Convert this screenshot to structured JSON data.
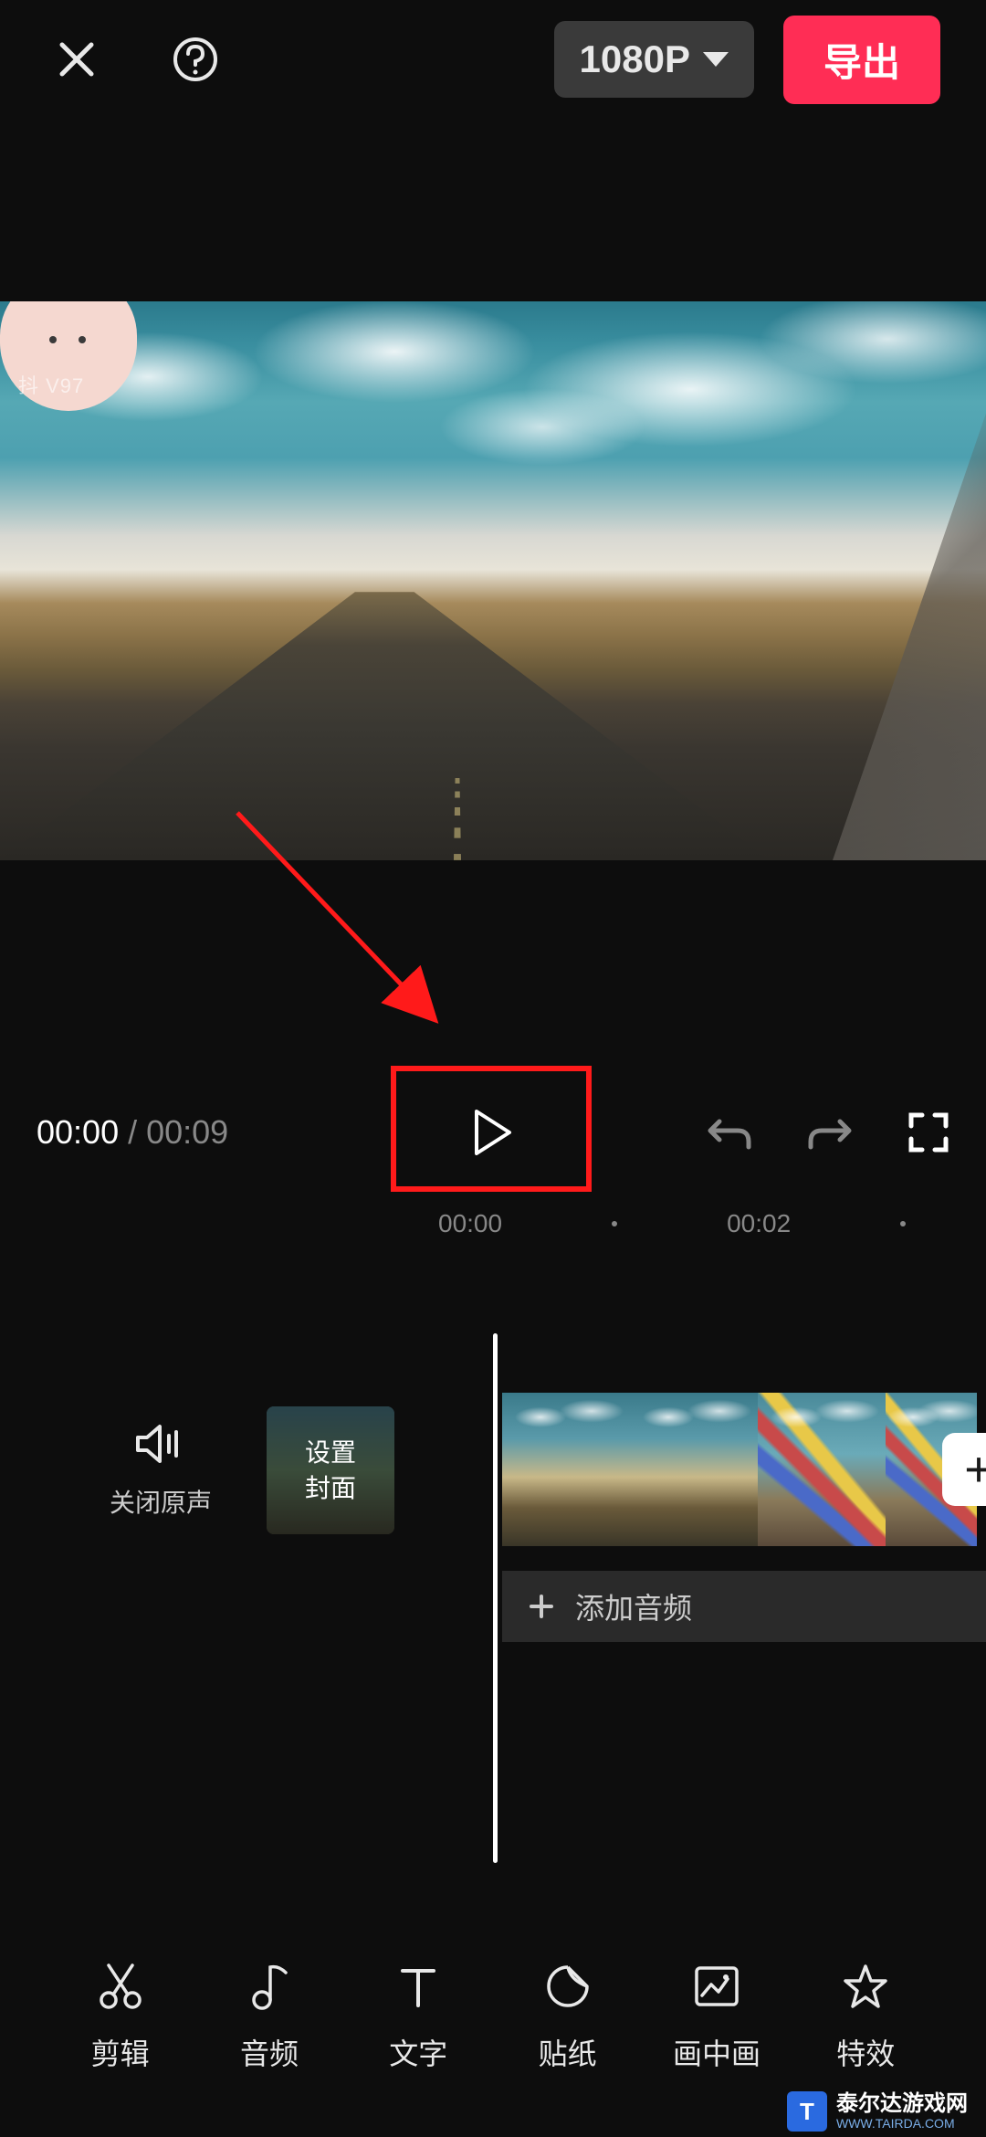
{
  "header": {
    "resolution_label": "1080P",
    "export_label": "导出"
  },
  "preview": {
    "watermark_text": "抖         V97"
  },
  "playback": {
    "current_time": "00:00",
    "separator": "/",
    "total_time": "00:09"
  },
  "ruler": {
    "marks": [
      "00:00",
      "00:02"
    ]
  },
  "tracks": {
    "mute_label": "关闭原声",
    "cover_line1": "设置",
    "cover_line2": "封面",
    "add_audio_label": "添加音频",
    "add_clip_label": "+"
  },
  "toolbar": {
    "items": [
      {
        "label": "剪辑"
      },
      {
        "label": "音频"
      },
      {
        "label": "文字"
      },
      {
        "label": "贴纸"
      },
      {
        "label": "画中画"
      },
      {
        "label": "特效"
      }
    ]
  },
  "site_watermark": {
    "badge": "T",
    "name": "泰尔达游戏网",
    "url": "WWW.TAIRDA.COM"
  }
}
